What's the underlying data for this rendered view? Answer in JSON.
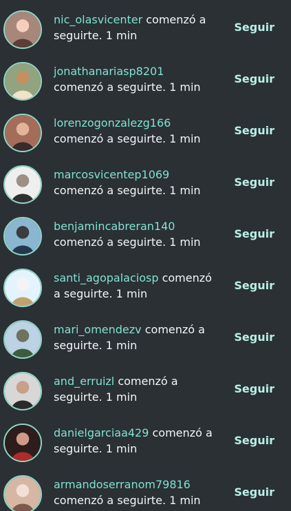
{
  "follow_label": "Seguir",
  "items": [
    {
      "username": "nic_olasvicenter",
      "text": " comenzó a seguirte. 1 min",
      "avatar_colors": [
        "#a8877b",
        "#5b3e37",
        "#f4cfbe"
      ]
    },
    {
      "username": "jonathanariasp8201",
      "text": "comenzó a seguirte. 1 min",
      "avatar_colors": [
        "#91a37f",
        "#efe4c8",
        "#c58f5f"
      ]
    },
    {
      "username": "lorenzogonzalezg166",
      "text": "comenzó a seguirte. 1 min",
      "avatar_colors": [
        "#a46d5a",
        "#372b2b",
        "#e2b49a"
      ]
    },
    {
      "username": "marcosvicentep1069",
      "text": "comenzó a seguirte. 1 min",
      "avatar_colors": [
        "#efefef",
        "#2f2f2f",
        "#9d8f84"
      ]
    },
    {
      "username": "benjamincabreran140",
      "text": "comenzó a seguirte. 1 min",
      "avatar_colors": [
        "#8ab6d1",
        "#23384d",
        "#3c3c3c"
      ]
    },
    {
      "username": "santi_agopalaciosp",
      "text": " comenzó a seguirte. 1 min",
      "avatar_colors": [
        "#e3f4ff",
        "#c0a271",
        "#f4f4f4"
      ]
    },
    {
      "username": "mari_omendezv",
      "text": " comenzó a seguirte. 1 min",
      "avatar_colors": [
        "#bcd2e5",
        "#3c5d3d",
        "#6d735f"
      ]
    },
    {
      "username": "and_erruizl",
      "text": " comenzó a seguirte. 1 min",
      "avatar_colors": [
        "#d7d7d7",
        "#2a2a2a",
        "#c99f88"
      ]
    },
    {
      "username": "danielgarciaa429",
      "text": " comenzó a seguirte. 1 min",
      "avatar_colors": [
        "#2d1d1d",
        "#b12b2b",
        "#d29a86"
      ]
    },
    {
      "username": "armandoserranom79816",
      "text": "comenzó a seguirte. 1 min",
      "avatar_colors": [
        "#d6b7a4",
        "#7b5a4b",
        "#f2e0d6"
      ]
    }
  ]
}
